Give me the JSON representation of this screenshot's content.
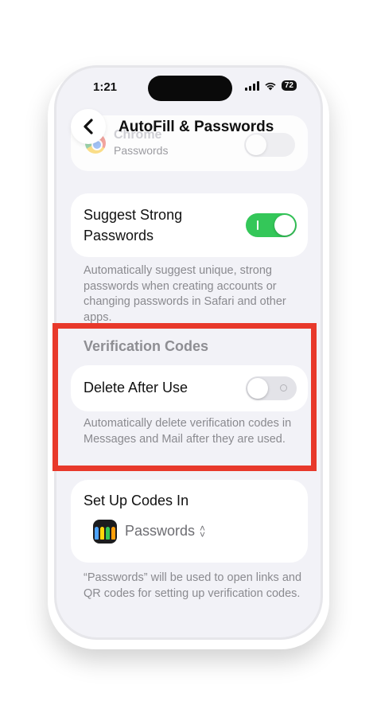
{
  "status": {
    "time": "1:21",
    "battery": "72"
  },
  "nav": {
    "title": "AutoFill & Passwords",
    "back_icon": "chevron-left-icon"
  },
  "chrome_row": {
    "name": "Chrome",
    "subtitle": "Passwords",
    "toggle_on": false
  },
  "suggest": {
    "label": "Suggest Strong Passwords",
    "toggle_on": true,
    "footnote": "Automatically suggest unique, strong passwords when creating accounts or changing passwords in Safari and other apps."
  },
  "verification": {
    "header": "Verification Codes",
    "delete_label": "Delete After Use",
    "delete_toggle_on": false,
    "footnote": "Automatically delete verification codes in Messages and Mail after they are used."
  },
  "setup": {
    "label": "Set Up Codes In",
    "selected_app": "Passwords",
    "footnote": "“Passwords” will be used to open links and QR codes for setting up verification codes."
  },
  "colors": {
    "toggle_on": "#34c759",
    "highlight": "#e8392b",
    "background": "#f2f2f7"
  }
}
